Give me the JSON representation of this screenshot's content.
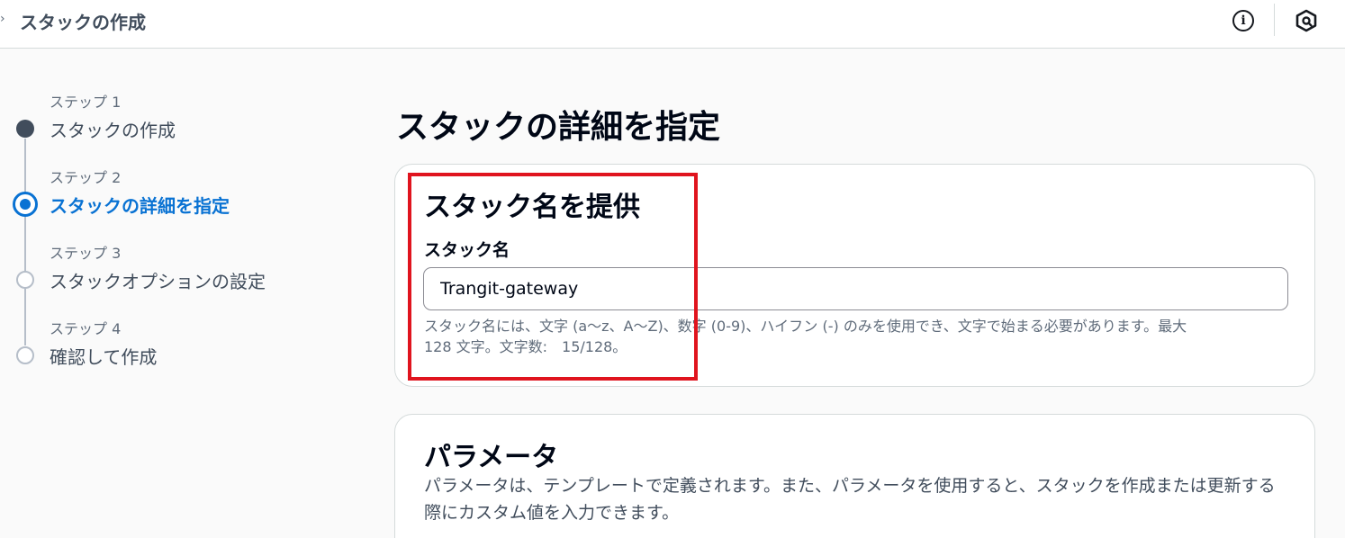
{
  "header": {
    "breadcrumb": "スタックの作成"
  },
  "steps": [
    {
      "label": "ステップ 1",
      "title": "スタックの作成",
      "state": "done"
    },
    {
      "label": "ステップ 2",
      "title": "スタックの詳細を指定",
      "state": "current"
    },
    {
      "label": "ステップ 3",
      "title": "スタックオプションの設定",
      "state": "todo"
    },
    {
      "label": "ステップ 4",
      "title": "確認して作成",
      "state": "todo"
    }
  ],
  "main": {
    "title": "スタックの詳細を指定",
    "stack_name_section": {
      "heading": "スタック名を提供",
      "field_label": "スタック名",
      "value": "Trangit-gateway",
      "hint_line1": "スタック名には、文字 (a〜z、A〜Z)、数字 (0-9)、ハイフン (-) のみを使用でき、文字で始まる必要があります。最大",
      "hint_line2": "128 文字。文字数:　15/128。"
    },
    "parameters_section": {
      "heading": "パラメータ",
      "description": "パラメータは、テンプレートで定義されます。また、パラメータを使用すると、スタックを作成または更新する際にカスタム値を入力できます。"
    }
  },
  "colors": {
    "accent": "#0972d3",
    "highlight": "#e0141e"
  }
}
